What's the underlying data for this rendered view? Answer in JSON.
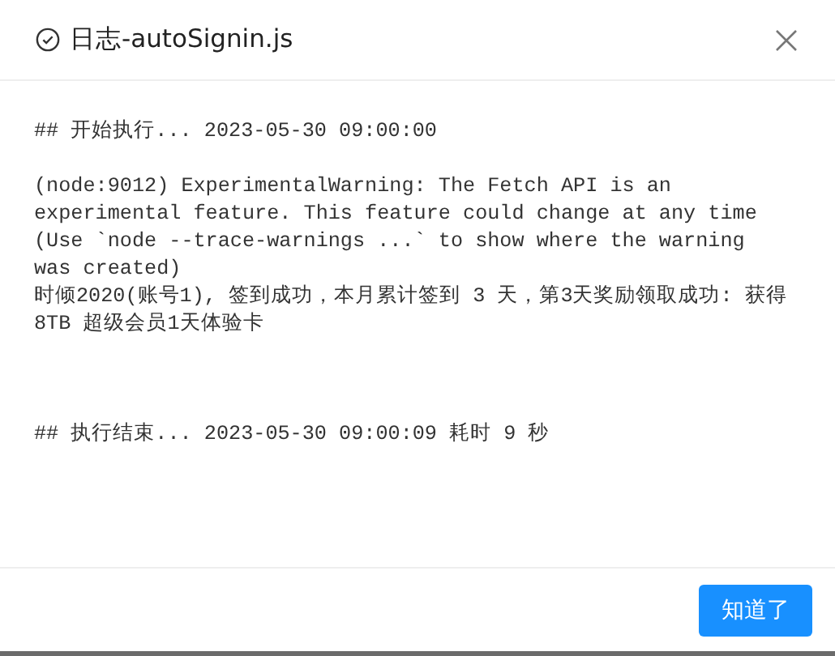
{
  "dialog": {
    "title": "日志-autoSignin.js",
    "log": [
      {
        "kind": "heading",
        "text": "## 开始执行... 2023-05-30 09:00:00"
      },
      {
        "kind": "output",
        "text": "(node:9012) ExperimentalWarning: The Fetch API is an experimental feature. This feature could change at any time (Use `node --trace-warnings ...` to show where the warning was created)"
      },
      {
        "kind": "output",
        "text": "时倾2020(账号1), 签到成功，本月累计签到 3 天，第3天奖励领取成功: 获得8TB 超级会员1天体验卡"
      },
      {
        "kind": "heading",
        "text": "## 执行结束... 2023-05-30 09:00:09 耗时 9 秒"
      }
    ],
    "buttons": [
      {
        "label": "知道了",
        "kind": "primary"
      }
    ]
  }
}
